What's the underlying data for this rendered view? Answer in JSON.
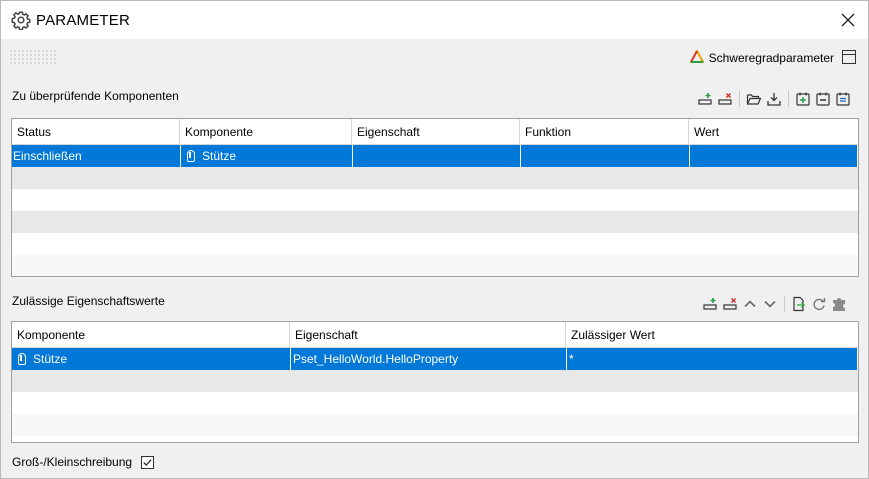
{
  "window": {
    "title": "PARAMETER",
    "title_icon": "gear-icon",
    "close_icon": "close-icon"
  },
  "header": {
    "severity_label": "Schweregradparameter",
    "severity_icon": "warning-triangle-icon"
  },
  "components_section": {
    "label": "Zu überprüfende Komponenten",
    "toolbar": [
      "add-row-icon",
      "remove-row-icon",
      "open-folder-icon",
      "download-icon",
      "add-item-icon",
      "remove-item-icon",
      "list-item-icon"
    ],
    "columns": [
      "Status",
      "Komponente",
      "Eigenschaft",
      "Funktion",
      "Wert"
    ],
    "rows": [
      {
        "status": "Einschließen",
        "komponente": "Stütze",
        "eigenschaft": "",
        "funktion": "",
        "wert": ""
      }
    ]
  },
  "values_section": {
    "label": "Zulässige Eigenschaftswerte",
    "toolbar": [
      "add-row-icon",
      "remove-row-icon",
      "move-up-icon",
      "move-down-icon",
      "export-icon",
      "refresh-icon",
      "puzzle-icon"
    ],
    "columns": [
      "Komponente",
      "Eigenschaft",
      "Zulässiger Wert"
    ],
    "rows": [
      {
        "komponente": "Stütze",
        "eigenschaft": "Pset_HelloWorld.HelloProperty",
        "wert": "*"
      }
    ]
  },
  "options": {
    "case_sensitive_label": "Groß-/Kleinschreibung",
    "case_sensitive_checked": true
  },
  "colors": {
    "selection": "#0078d7",
    "alt_row": "#e8e8e8"
  }
}
